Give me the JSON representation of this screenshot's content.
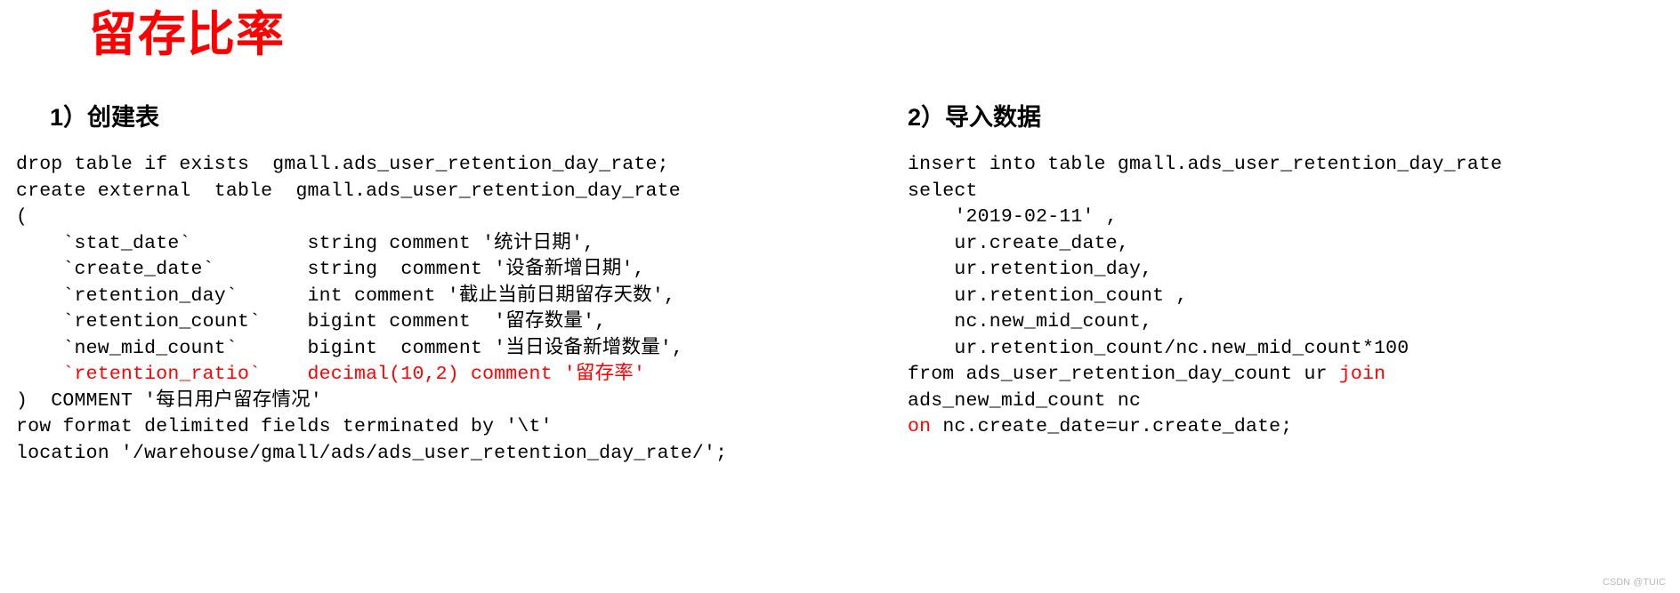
{
  "title": "留存比率",
  "title_color": "#ff0000",
  "code_color": "#000000",
  "highlight_color": "#ff0000",
  "left": {
    "heading": "1）创建表",
    "code_lines": [
      {
        "text": "drop table if exists  gmall.ads_user_retention_day_rate;",
        "color": "black"
      },
      {
        "text": "create external  table  gmall.ads_user_retention_day_rate",
        "color": "black"
      },
      {
        "text": "(",
        "color": "black"
      },
      {
        "text": "    `stat_date`          string comment '统计日期',",
        "color": "black"
      },
      {
        "text": "    `create_date`        string  comment '设备新增日期',",
        "color": "black"
      },
      {
        "text": "    `retention_day`      int comment '截止当前日期留存天数',",
        "color": "black"
      },
      {
        "text": "    `retention_count`    bigint comment  '留存数量',",
        "color": "black"
      },
      {
        "text": "    `new_mid_count`      bigint  comment '当日设备新增数量',",
        "color": "black"
      },
      {
        "text": "    `retention_ratio`    decimal(10,2) comment '留存率'",
        "color": "red"
      },
      {
        "text": ")  COMMENT '每日用户留存情况'",
        "color": "black"
      },
      {
        "text": "row format delimited fields terminated by '\\t'",
        "color": "black"
      },
      {
        "text": "location '/warehouse/gmall/ads/ads_user_retention_day_rate/';",
        "color": "black"
      }
    ]
  },
  "right": {
    "heading": "2）导入数据",
    "code_lines": [
      {
        "text": "insert into table gmall.ads_user_retention_day_rate",
        "color": "black"
      },
      {
        "text": "select",
        "color": "black"
      },
      {
        "text": "    '2019-02-11' ,",
        "color": "black"
      },
      {
        "text": "    ur.create_date,",
        "color": "black"
      },
      {
        "text": "    ur.retention_day,",
        "color": "black"
      },
      {
        "text": "    ur.retention_count ,",
        "color": "black"
      },
      {
        "text": "    nc.new_mid_count,",
        "color": "black"
      },
      {
        "text": "    ur.retention_count/nc.new_mid_count*100",
        "color": "black"
      },
      {
        "segments": [
          {
            "text": "from ads_user_retention_day_count ur ",
            "color": "black"
          },
          {
            "text": "join",
            "color": "red"
          }
        ]
      },
      {
        "text": "ads_new_mid_count nc",
        "color": "black"
      },
      {
        "segments": [
          {
            "text": "on ",
            "color": "red"
          },
          {
            "text": "nc.create_date=ur.create_date;",
            "color": "black"
          }
        ]
      }
    ]
  },
  "watermark": "CSDN @TUIC"
}
